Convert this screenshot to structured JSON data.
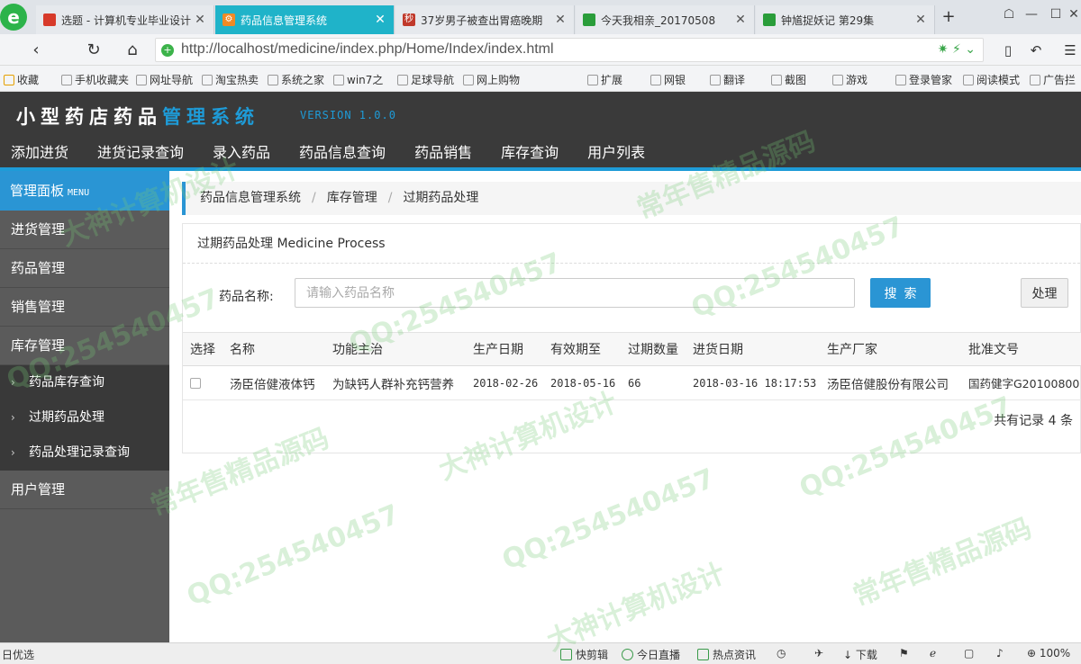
{
  "browser": {
    "tabs": [
      {
        "title": "选题 - 计算机专业毕业设计",
        "favicon_color": "#d73a2a",
        "active": false
      },
      {
        "title": "药品信息管理系统",
        "favicon_color": "#f08a24",
        "active": true
      },
      {
        "title": "37岁男子被查出胃癌晚期",
        "favicon_color": "#c0392b",
        "active": false
      },
      {
        "title": "今天我相亲_20170508",
        "favicon_color": "#2a9d3a",
        "active": false
      },
      {
        "title": "钟馗捉妖记 第29集",
        "favicon_color": "#2a9d3a",
        "active": false
      }
    ],
    "new_tab_label": "+",
    "address": {
      "url": "http://localhost/medicine/index.php/Home/Index/index.html"
    },
    "bookmarks": [
      {
        "label": "收藏",
        "icon": "star-icon"
      },
      {
        "label": "手机收藏夹",
        "icon": "phone-icon"
      },
      {
        "label": "网址导航",
        "icon": "page-icon"
      },
      {
        "label": "淘宝热卖",
        "icon": "page-icon"
      },
      {
        "label": "系统之家",
        "icon": "page-icon"
      },
      {
        "label": "win7之",
        "icon": "page-icon"
      },
      {
        "label": "足球导航",
        "icon": "page-icon"
      },
      {
        "label": "网上购物",
        "icon": "page-icon"
      },
      {
        "label": "扩展",
        "icon": "grid-icon"
      },
      {
        "label": "网银",
        "icon": "bank-icon"
      },
      {
        "label": "翻译",
        "icon": "translate-icon"
      },
      {
        "label": "截图",
        "icon": "scissors-icon"
      },
      {
        "label": "游戏",
        "icon": "gamepad-icon"
      },
      {
        "label": "登录管家",
        "icon": "key-icon"
      },
      {
        "label": "阅读模式",
        "icon": "book-icon"
      },
      {
        "label": "广告拦",
        "icon": "block-icon"
      }
    ],
    "status": {
      "left": "日优选",
      "items": [
        "快剪辑",
        "今日直播",
        "热点资讯",
        "下载"
      ],
      "zoom": "100%"
    }
  },
  "app": {
    "title_plain": "小型药店药品",
    "title_accent": "管理系统",
    "version": "VERSION 1.0.0",
    "nav": [
      "添加进货",
      "进货记录查询",
      "录入药品",
      "药品信息查询",
      "药品销售",
      "库存查询",
      "用户列表"
    ]
  },
  "sidebar": {
    "header": "管理面板",
    "header_tag": "MENU",
    "groups_top": [
      "进货管理",
      "药品管理",
      "销售管理",
      "库存管理"
    ],
    "sub_items": [
      "药品库存查询",
      "过期药品处理",
      "药品处理记录查询"
    ],
    "groups_bottom": [
      "用户管理"
    ]
  },
  "breadcrumb": [
    "药品信息管理系统",
    "库存管理",
    "过期药品处理"
  ],
  "panel": {
    "title": "过期药品处理 Medicine Process",
    "search_label": "药品名称:",
    "search_placeholder": "请输入药品名称",
    "search_value": "",
    "search_button": "搜索",
    "process_button": "处理"
  },
  "table": {
    "columns": [
      "选择",
      "名称",
      "功能主治",
      "生产日期",
      "有效期至",
      "过期数量",
      "进货日期",
      "生产厂家",
      "批准文号"
    ],
    "rows": [
      {
        "checked": false,
        "name": "汤臣倍健液体钙",
        "function": "为缺钙人群补充钙营养",
        "production_date": "2018-02-26",
        "expiry_date": "2018-05-16",
        "expired_quantity": "66",
        "purchase_date": "2018-03-16 18:17:53",
        "manufacturer": "汤臣倍健股份有限公司",
        "approval_no": "国药健字G20100800"
      }
    ],
    "total_text": "共有记录 4 条"
  },
  "watermark": [
    "QQ:254540457",
    "常年售精品源码",
    "大神计算机设计"
  ]
}
